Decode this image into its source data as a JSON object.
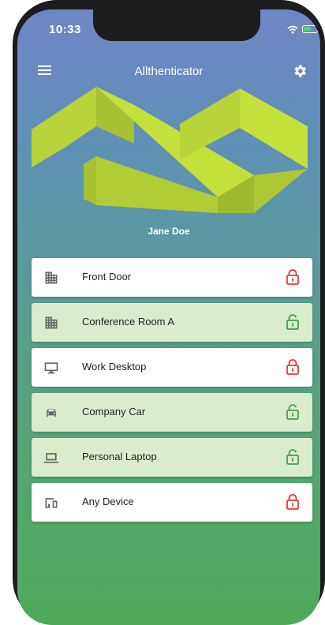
{
  "status_bar": {
    "time": "10:33",
    "signal": "....",
    "wifi_icon": "wifi-icon",
    "battery_icon": "battery-icon"
  },
  "app_bar": {
    "title": "Allthenticator",
    "menu_icon": "hamburger-menu-icon",
    "settings_icon": "gear-icon"
  },
  "profile": {
    "name": "Jane Doe"
  },
  "colors": {
    "locked": "#e53935",
    "unlocked": "#43a047",
    "unlocked_bg": "#dbeccc",
    "logo": "#c4e03a"
  },
  "devices": [
    {
      "label": "Front Door",
      "icon": "building-icon",
      "state": "locked"
    },
    {
      "label": "Conference Room A",
      "icon": "building-icon",
      "state": "unlocked"
    },
    {
      "label": "Work Desktop",
      "icon": "desktop-icon",
      "state": "locked"
    },
    {
      "label": "Company Car",
      "icon": "car-icon",
      "state": "unlocked"
    },
    {
      "label": "Personal Laptop",
      "icon": "laptop-icon",
      "state": "unlocked"
    },
    {
      "label": "Any Device",
      "icon": "devices-icon",
      "state": "locked"
    }
  ]
}
